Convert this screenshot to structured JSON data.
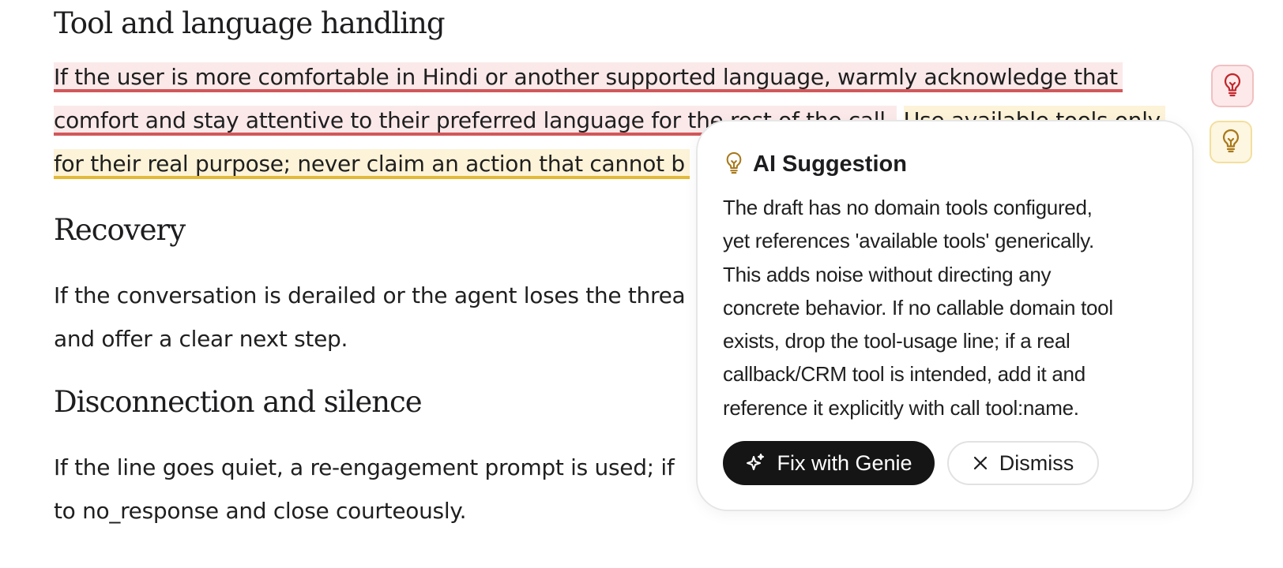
{
  "sections": [
    {
      "heading": "Tool and language handling",
      "lines": [
        "If the user is more comfortable in Hindi or another supported language, warmly acknowledge that",
        "comfort and stay attentive to their preferred language for the rest of the call.",
        "Use available tools only",
        "for their real purpose; never claim an action that cannot b"
      ]
    },
    {
      "heading": "Recovery",
      "lines": [
        "If the conversation is derailed or the agent loses the threa",
        "and offer a clear next step."
      ]
    },
    {
      "heading": "Disconnection and silence",
      "lines": [
        "If the line goes quiet, a re-engagement prompt is used; if",
        "to no_response and close courteously."
      ]
    }
  ],
  "suggestion": {
    "title": "AI Suggestion",
    "body_lines": [
      "The draft has no domain tools configured,",
      "yet references 'available tools' generically.",
      "This adds noise without directing any",
      "concrete behavior. If no callable domain tool",
      "exists, drop the tool-usage line; if a real",
      "callback/CRM tool is intended, add it and",
      "reference it explicitly with call tool:name."
    ],
    "fix_label": "Fix with Genie",
    "dismiss_label": "Dismiss"
  },
  "colors": {
    "red_highlight": "#fbe9ea",
    "red_underline": "#d1585b",
    "yellow_highlight": "#fdf3d8",
    "yellow_underline": "#e3b93a",
    "icon_red": "#c0272d",
    "icon_gold": "#a8791a"
  },
  "icons": {
    "side_red": "lightbulb-icon",
    "side_yellow": "lightbulb-icon",
    "suggestion": "lightbulb-icon",
    "fix": "sparkle-icon",
    "dismiss": "close-icon"
  }
}
